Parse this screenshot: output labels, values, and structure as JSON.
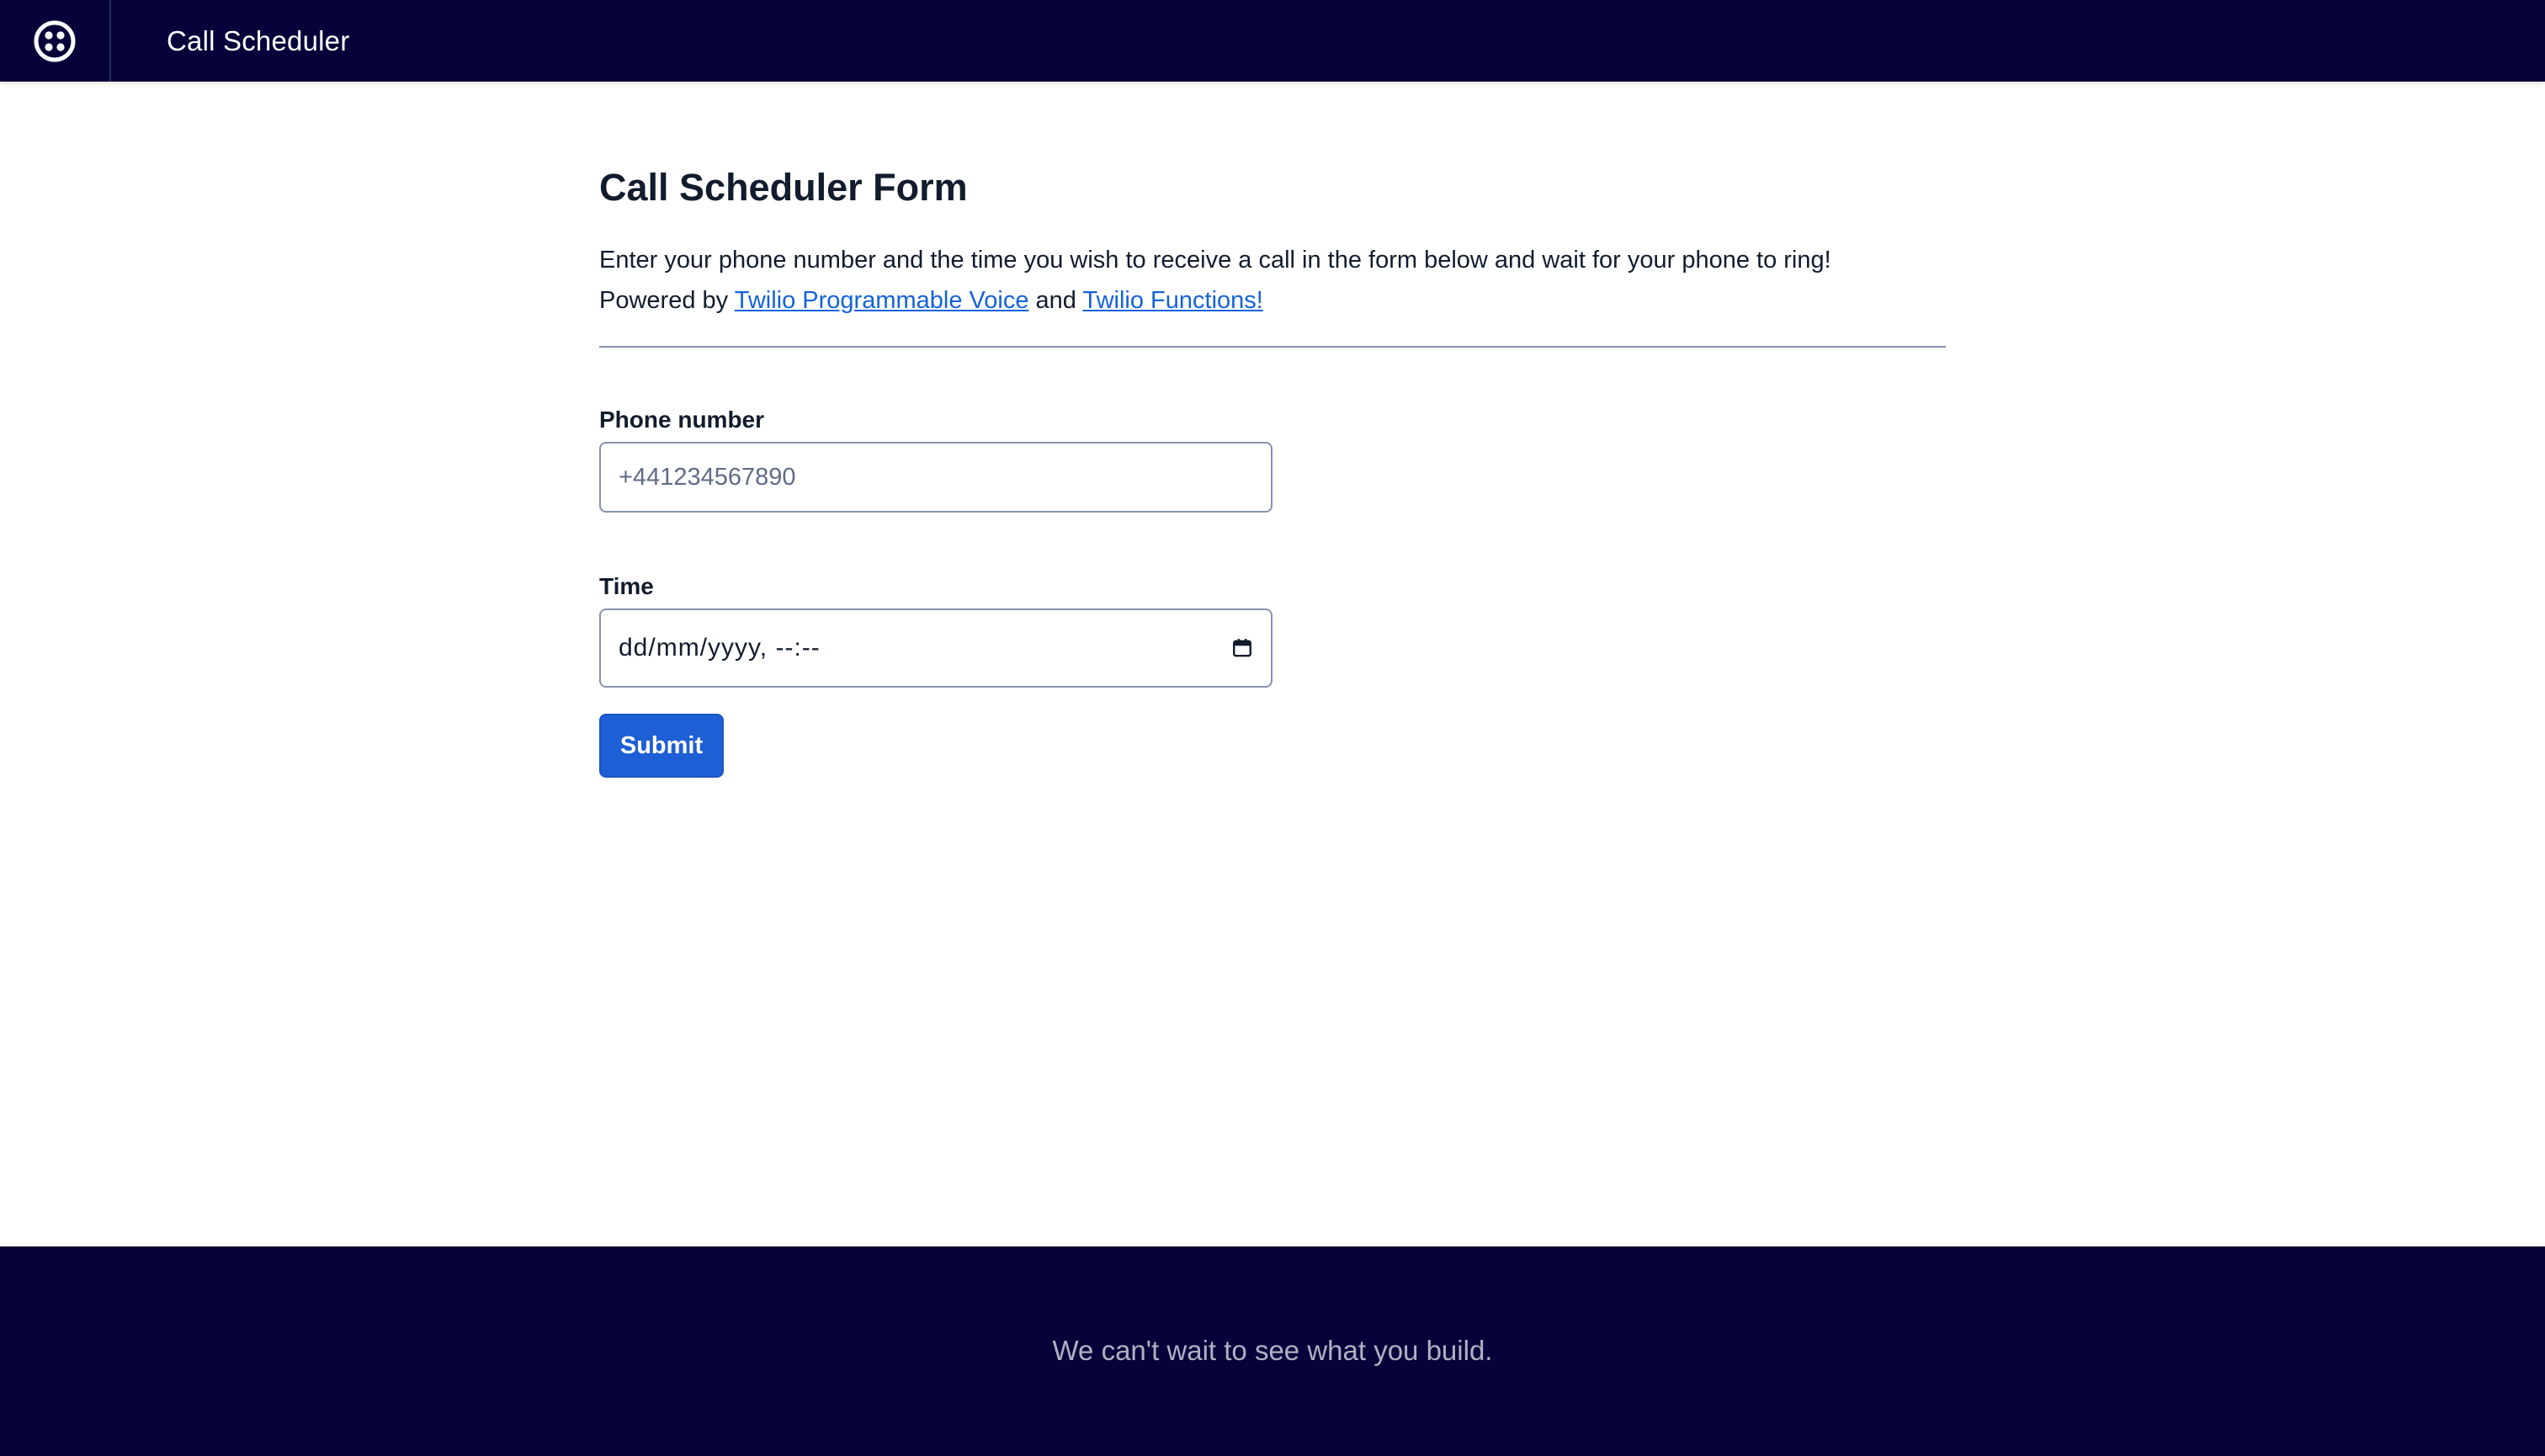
{
  "header": {
    "logo_icon": "twilio-logo-icon",
    "title": "Call Scheduler",
    "background": "#06033a"
  },
  "main": {
    "title": "Call Scheduler Form",
    "description_line1": "Enter your phone number and the time you wish to receive a call in the form below and wait for your phone to ring!",
    "powered_by_prefix": "Powered by",
    "link_voice": "Twilio Programmable Voice",
    "and_text": "and",
    "link_functions": "Twilio Functions!",
    "link_color": "#1363db"
  },
  "form": {
    "phone_label": "Phone number",
    "phone_placeholder": "+441234567890",
    "phone_value": "",
    "time_label": "Time",
    "time_value": "dd/mm/yyyy, --:--",
    "time_icon": "calendar-icon",
    "submit_label": "Submit",
    "submit_color": "#1f5fd6"
  },
  "footer": {
    "text": "We can't wait to see what you build.",
    "background": "#06033a"
  }
}
